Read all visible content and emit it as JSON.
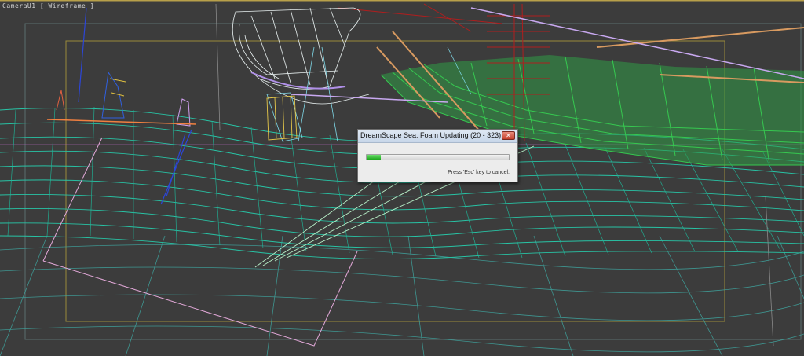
{
  "viewport": {
    "label": "CameraU1 [ Wireframe ]",
    "background": "#3c3c3c"
  },
  "dialog": {
    "title": "DreamScape Sea: Foam Updating (20 - 323)",
    "progress": 0.1,
    "cancel_hint": "Press 'Esc' key to cancel.",
    "close_icon": "close-icon",
    "colors": {
      "progress_fill": "#2fbf2f",
      "close_button": "#d0543f"
    }
  }
}
